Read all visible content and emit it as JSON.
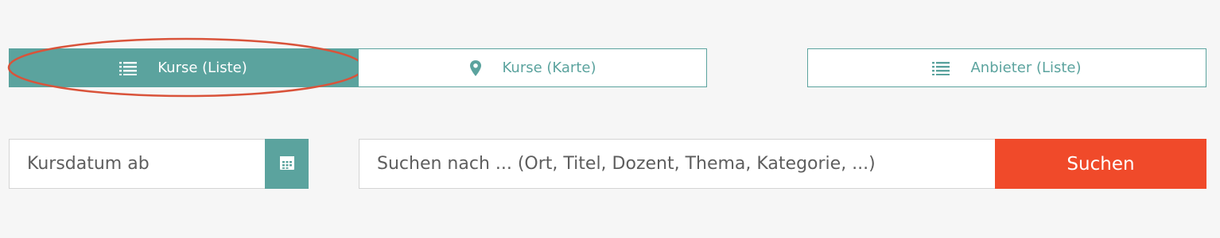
{
  "tabs": {
    "list": {
      "label": "Kurse (Liste)",
      "icon": "list-icon",
      "active": true
    },
    "map": {
      "label": "Kurse (Karte)",
      "icon": "map-pin-icon",
      "active": false
    },
    "provider": {
      "label": "Anbieter (Liste)",
      "icon": "list-icon",
      "active": false
    }
  },
  "date_filter": {
    "placeholder": "Kursdatum ab",
    "icon": "calendar-icon"
  },
  "search": {
    "placeholder": "Suchen nach ... (Ort, Titel, Dozent, Thema, Kategorie, ...)",
    "button_label": "Suchen"
  },
  "colors": {
    "accent": "#5ba39e",
    "search_button": "#f04a2a",
    "highlight": "#d9533a",
    "background": "#f6f6f6"
  }
}
